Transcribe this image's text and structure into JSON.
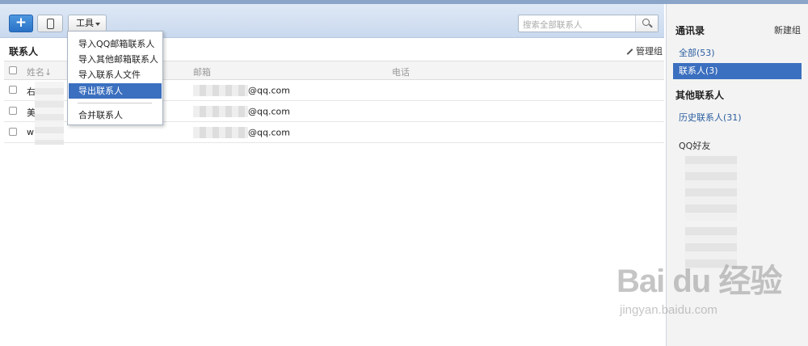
{
  "toolbar": {
    "add_label": "+",
    "tools_label": "工具",
    "search_placeholder": "搜索全部联系人"
  },
  "tools_menu": {
    "items": [
      {
        "label": "导入QQ邮箱联系人"
      },
      {
        "label": "导入其他邮箱联系人"
      },
      {
        "label": "导入联系人文件"
      },
      {
        "label": "导出联系人"
      },
      {
        "label": "合并联系人"
      }
    ]
  },
  "main": {
    "title": "联系人",
    "manage_label": "管理组",
    "columns": {
      "name": "姓名↓",
      "email": "邮箱",
      "phone": "电话"
    },
    "rows": [
      {
        "name": "右",
        "email_domain": "@qq.com"
      },
      {
        "name": "美",
        "email_domain": "@qq.com"
      },
      {
        "name": "w",
        "email_domain": "@qq.com"
      }
    ]
  },
  "sidebar": {
    "title": "通讯录",
    "new_group": "新建组",
    "all": "全部(53)",
    "contacts": "联系人(3)",
    "other_heading": "其他联系人",
    "history": "历史联系人(31)",
    "qq_friends": "QQ好友"
  },
  "watermark": {
    "brand": "Bai du 经验",
    "url": "jingyan.baidu.com"
  },
  "colors": {
    "accent": "#3b6fbf",
    "toolbar": "#c9d9ee",
    "link": "#2a5d9f"
  }
}
